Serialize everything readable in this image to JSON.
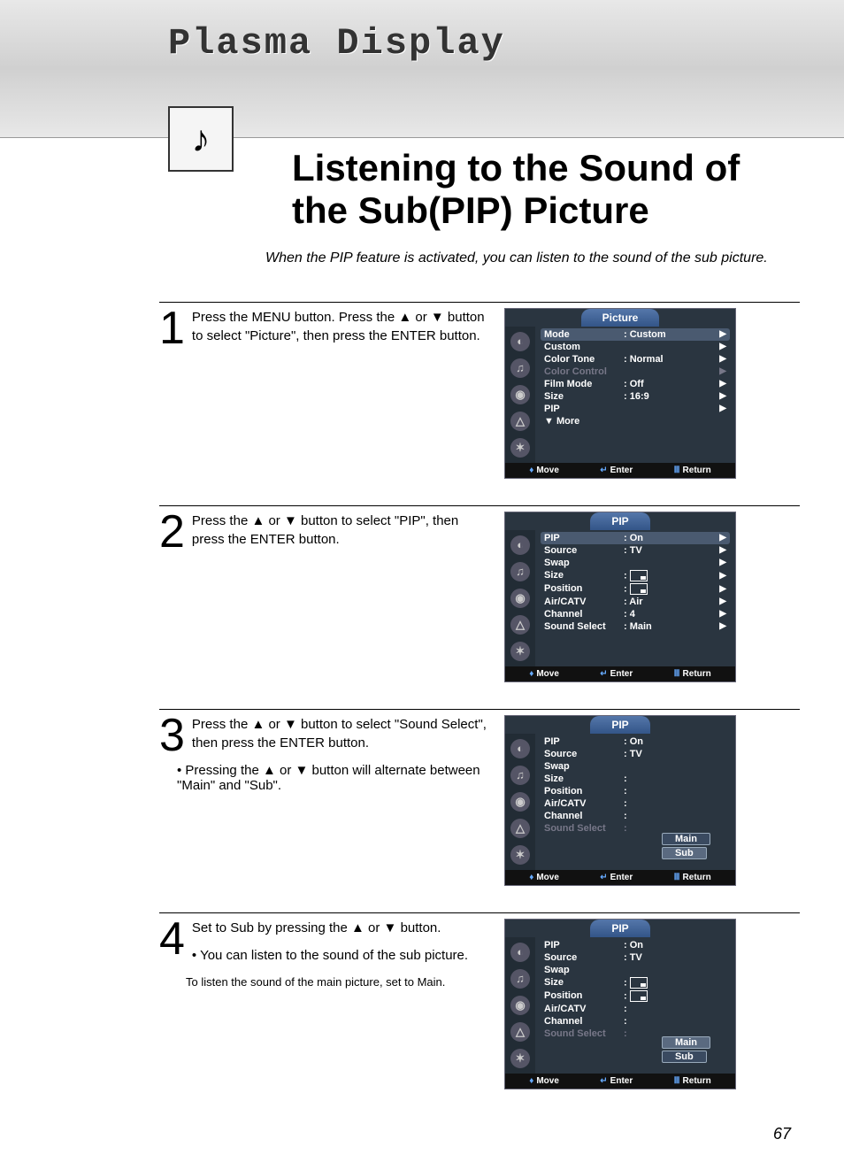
{
  "header": {
    "plasma": "Plasma Display",
    "title": "Listening to the Sound of the Sub(PIP) Picture"
  },
  "intro": "When the PIP feature is activated, you can listen to the sound of the sub picture.",
  "steps": [
    {
      "num": "1",
      "text": "Press the MENU button. Press the ▲ or ▼ button to select \"Picture\", then press the ENTER button."
    },
    {
      "num": "2",
      "text": "Press the ▲ or ▼ button to select \"PIP\", then press the ENTER button."
    },
    {
      "num": "3",
      "text": "Press the ▲ or ▼ button to select \"Sound Select\", then press the ENTER button.",
      "bullet": "Pressing the ▲ or ▼ button will alternate between \"Main\" and \"Sub\"."
    },
    {
      "num": "4",
      "text": "Set to Sub by pressing the ▲ or ▼ button.",
      "bullet": "You can listen to the sound of the sub picture.",
      "note": "To listen the sound of the main picture, set to Main."
    }
  ],
  "osd1": {
    "title": "Picture",
    "rows": [
      {
        "label": "Mode",
        "val": ":  Custom",
        "sel": true,
        "arrow": "▶"
      },
      {
        "label": "Custom",
        "val": "",
        "arrow": "▶"
      },
      {
        "label": "Color Tone",
        "val": ":  Normal",
        "arrow": "▶"
      },
      {
        "label": "Color Control",
        "val": "",
        "dis": true,
        "arrow": "▶"
      },
      {
        "label": "Film Mode",
        "val": ":  Off",
        "arrow": "▶"
      },
      {
        "label": "Size",
        "val": ":  16:9",
        "arrow": "▶"
      },
      {
        "label": "PIP",
        "val": "",
        "arrow": "▶"
      },
      {
        "label": "▼ More",
        "val": "",
        "arrow": ""
      }
    ]
  },
  "osd2": {
    "title": "PIP",
    "rows": [
      {
        "label": "PIP",
        "val": ":  On",
        "sel": true,
        "arrow": "▶"
      },
      {
        "label": "Source",
        "val": ":  TV",
        "arrow": "▶"
      },
      {
        "label": "Swap",
        "val": "",
        "arrow": "▶"
      },
      {
        "label": "Size",
        "val": ":  ",
        "rect": true,
        "arrow": "▶"
      },
      {
        "label": "Position",
        "val": ":  ",
        "rect": true,
        "arrow": "▶"
      },
      {
        "label": "Air/CATV",
        "val": ":  Air",
        "arrow": "▶"
      },
      {
        "label": "Channel",
        "val": ":  4",
        "arrow": "▶"
      },
      {
        "label": "Sound Select",
        "val": ":  Main",
        "arrow": "▶"
      }
    ]
  },
  "osd3": {
    "title": "PIP",
    "rows": [
      {
        "label": "PIP",
        "val": ":  On"
      },
      {
        "label": "Source",
        "val": ":  TV"
      },
      {
        "label": "Swap",
        "val": ""
      },
      {
        "label": "Size",
        "val": ":"
      },
      {
        "label": "Position",
        "val": ":"
      },
      {
        "label": "Air/CATV",
        "val": ":"
      },
      {
        "label": "Channel",
        "val": ":"
      },
      {
        "label": "Sound Select",
        "val": ":",
        "dis": true
      }
    ],
    "popup": [
      {
        "t": "Main",
        "sel": true
      },
      {
        "t": "Sub"
      }
    ]
  },
  "osd4": {
    "title": "PIP",
    "rows": [
      {
        "label": "PIP",
        "val": ":  On"
      },
      {
        "label": "Source",
        "val": ":  TV"
      },
      {
        "label": "Swap",
        "val": ""
      },
      {
        "label": "Size",
        "val": ":  ",
        "rect": true
      },
      {
        "label": "Position",
        "val": ":  ",
        "rect": true
      },
      {
        "label": "Air/CATV",
        "val": ":"
      },
      {
        "label": "Channel",
        "val": ":"
      },
      {
        "label": "Sound Select",
        "val": ":",
        "dis": true
      }
    ],
    "popup": [
      {
        "t": "Main"
      },
      {
        "t": "Sub",
        "sel": true
      }
    ]
  },
  "foot": {
    "move": "Move",
    "enter": "Enter",
    "ret": "Return"
  },
  "pagenum": "67"
}
